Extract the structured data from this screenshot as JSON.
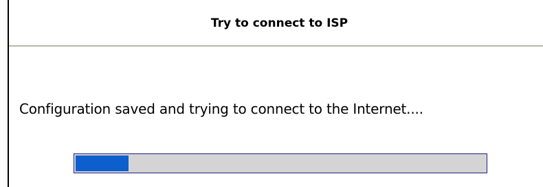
{
  "dialog": {
    "title": "Try to connect to ISP",
    "message": "Configuration saved and trying to connect to the Internet....",
    "progress": {
      "fraction": 0.13,
      "fill_color": "#0c5fcc",
      "track_color": "#d4d4d4",
      "border_color": "#1e1e8c"
    }
  }
}
